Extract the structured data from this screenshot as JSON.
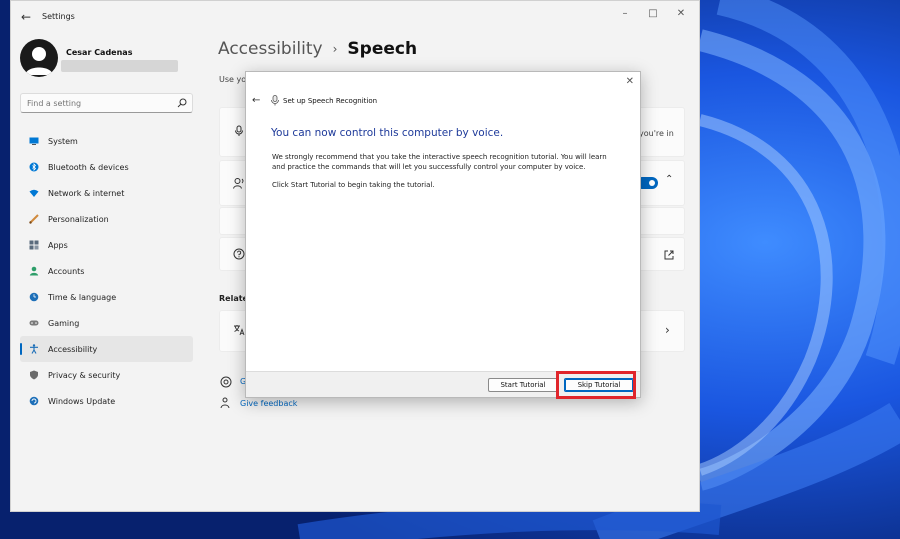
{
  "window": {
    "title": "Settings"
  },
  "profile": {
    "name": "Cesar Cadenas"
  },
  "search": {
    "placeholder": "Find a setting"
  },
  "nav": {
    "items": [
      {
        "label": "System",
        "icon": "monitor-icon",
        "color": "#0078d4"
      },
      {
        "label": "Bluetooth & devices",
        "icon": "bluetooth-icon",
        "color": "#0078d4"
      },
      {
        "label": "Network & internet",
        "icon": "wifi-icon",
        "color": "#0078d4"
      },
      {
        "label": "Personalization",
        "icon": "brush-icon",
        "color": "#d08a3c"
      },
      {
        "label": "Apps",
        "icon": "apps-icon",
        "color": "#5a6b7d"
      },
      {
        "label": "Accounts",
        "icon": "person-icon",
        "color": "#2e9e6a"
      },
      {
        "label": "Time & language",
        "icon": "globe-clock-icon",
        "color": "#1d6fb8"
      },
      {
        "label": "Gaming",
        "icon": "gamepad-icon",
        "color": "#7a7a7a"
      },
      {
        "label": "Accessibility",
        "icon": "accessibility-icon",
        "color": "#1d6fb8",
        "selected": true
      },
      {
        "label": "Privacy & security",
        "icon": "shield-icon",
        "color": "#6b6b6b"
      },
      {
        "label": "Windows Update",
        "icon": "update-icon",
        "color": "#1d6fb8"
      }
    ]
  },
  "breadcrumb": {
    "parent": "Accessibility",
    "current": "Speech"
  },
  "main": {
    "description_partial": "Use yo",
    "card_partial_text": "you're in",
    "related_label": "Related",
    "help_link_partial": "G",
    "feedback_link": "Give feedback"
  },
  "dialog": {
    "title": "Set up Speech Recognition",
    "heading": "You can now control this computer by voice.",
    "paragraph": "We strongly recommend that you take the interactive speech recognition tutorial. You will learn and practice the commands that will let you successfully control your computer by voice.",
    "paragraph2": "Click Start Tutorial to begin taking the tutorial.",
    "start_button": "Start Tutorial",
    "skip_button": "Skip Tutorial"
  },
  "colors": {
    "accent": "#0067c0",
    "highlight": "#e0252b",
    "dialog_heading": "#1e3a9a"
  }
}
